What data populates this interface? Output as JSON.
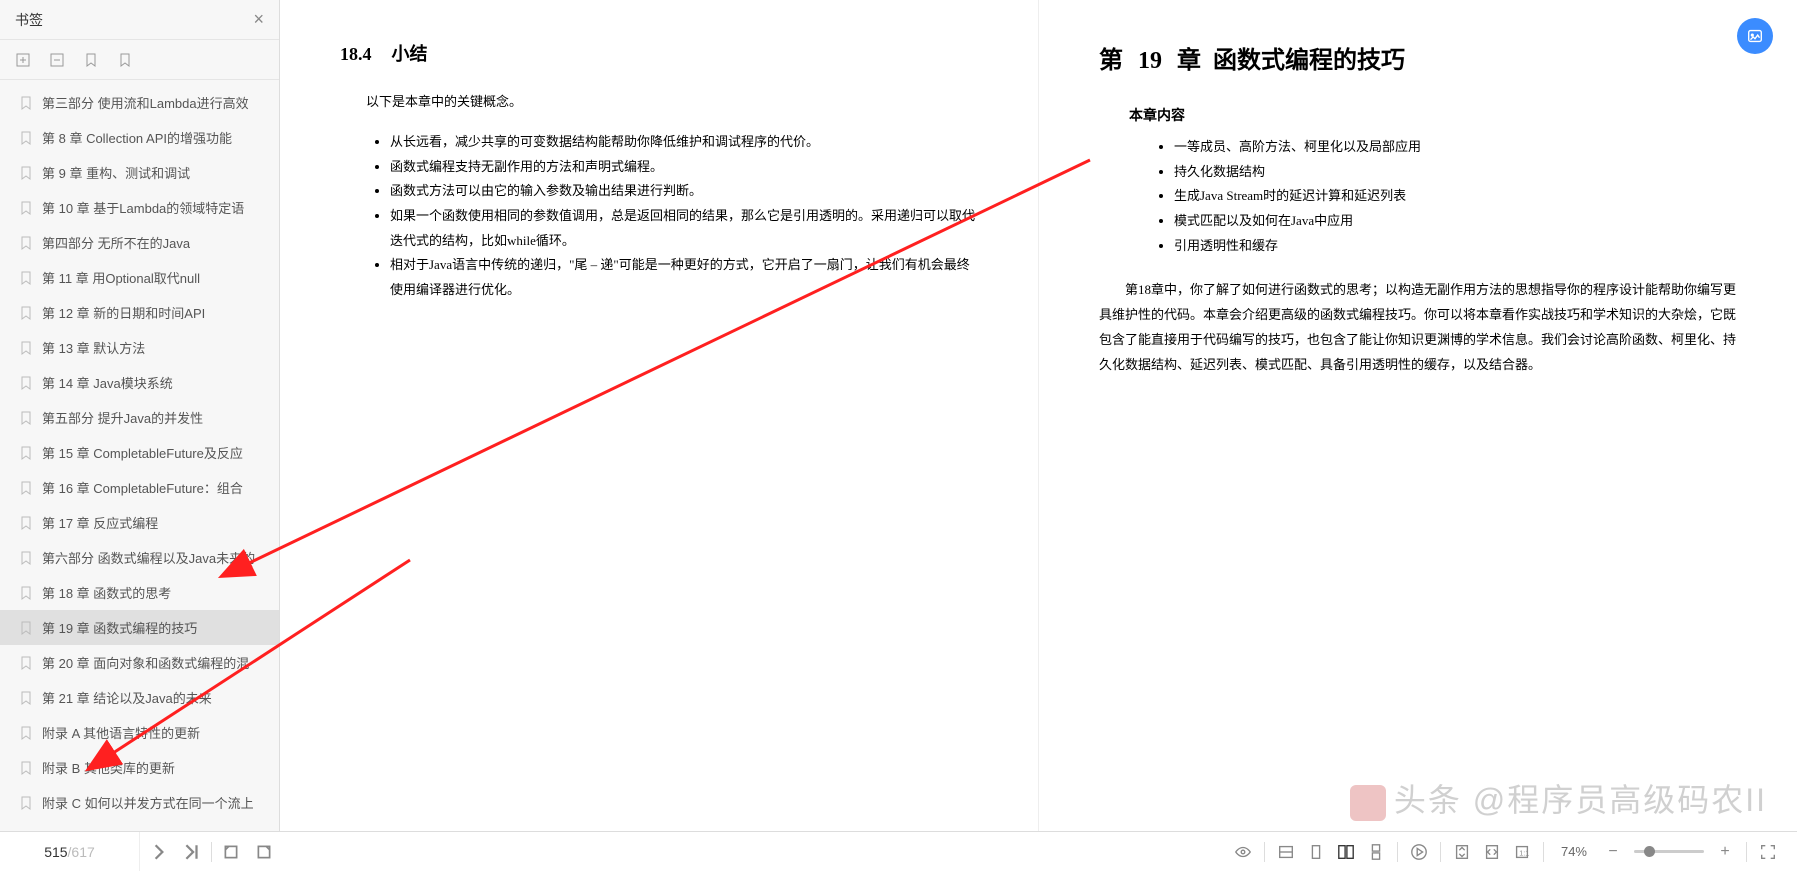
{
  "sidebar": {
    "title": "书签",
    "items": [
      {
        "label": "第三部分  使用流和Lambda进行高效",
        "selected": false
      },
      {
        "label": "第 8 章  Collection API的增强功能",
        "selected": false
      },
      {
        "label": "第 9 章  重构、测试和调试",
        "selected": false
      },
      {
        "label": "第 10 章  基于Lambda的领域特定语",
        "selected": false
      },
      {
        "label": "第四部分  无所不在的Java",
        "selected": false
      },
      {
        "label": "第 11 章  用Optional取代null",
        "selected": false
      },
      {
        "label": "第 12 章  新的日期和时间API",
        "selected": false
      },
      {
        "label": "第 13 章  默认方法",
        "selected": false
      },
      {
        "label": "第 14 章  Java模块系统",
        "selected": false
      },
      {
        "label": "第五部分  提升Java的并发性",
        "selected": false
      },
      {
        "label": "第 15 章  CompletableFuture及反应",
        "selected": false
      },
      {
        "label": "第 16 章  CompletableFuture：组合",
        "selected": false
      },
      {
        "label": "第 17 章  反应式编程",
        "selected": false
      },
      {
        "label": "第六部分  函数式编程以及Java未来的",
        "selected": false
      },
      {
        "label": "第 18 章  函数式的思考",
        "selected": false
      },
      {
        "label": "第 19 章  函数式编程的技巧",
        "selected": true
      },
      {
        "label": "第 20 章  面向对象和函数式编程的混",
        "selected": false
      },
      {
        "label": "第 21 章  结论以及Java的未来",
        "selected": false
      },
      {
        "label": "附录 A  其他语言特性的更新",
        "selected": false
      },
      {
        "label": "附录 B  其他类库的更新",
        "selected": false
      },
      {
        "label": "附录 C  如何以并发方式在同一个流上",
        "selected": false
      }
    ]
  },
  "page_left": {
    "section_num": "18.4",
    "section_title": "小结",
    "intro": "以下是本章中的关键概念。",
    "bullets": [
      "从长远看，减少共享的可变数据结构能帮助你降低维护和调试程序的代价。",
      "函数式编程支持无副作用的方法和声明式编程。",
      "函数式方法可以由它的输入参数及输出结果进行判断。",
      "如果一个函数使用相同的参数值调用，总是返回相同的结果，那么它是引用透明的。采用递归可以取代迭代式的结构，比如while循环。",
      "相对于Java语言中传统的递归，\"尾 – 递\"可能是一种更好的方式，它开启了一扇门，让我们有机会最终使用编译器进行优化。"
    ]
  },
  "page_right": {
    "chapter_prefix": "第",
    "chapter_num": "19",
    "chapter_suffix": "章",
    "chapter_title": "函数式编程的技巧",
    "sub_heading": "本章内容",
    "content_items": [
      "一等成员、高阶方法、柯里化以及局部应用",
      "持久化数据结构",
      "生成Java Stream时的延迟计算和延迟列表",
      "模式匹配以及如何在Java中应用",
      "引用透明性和缓存"
    ],
    "paragraph": "第18章中，你了解了如何进行函数式的思考；以构造无副作用方法的思想指导你的程序设计能帮助你编写更具维护性的代码。本章会介绍更高级的函数式编程技巧。你可以将本章看作实战技巧和学术知识的大杂烩，它既包含了能直接用于代码编写的技巧，也包含了能让你知识更渊博的学术信息。我们会讨论高阶函数、柯里化、持久化数据结构、延迟列表、模式匹配、具备引用透明性的缓存，以及结合器。"
  },
  "bottom": {
    "page_current": "515",
    "page_total": "/617",
    "zoom": "74%"
  },
  "watermark": "头条 @程序员高级码农II"
}
